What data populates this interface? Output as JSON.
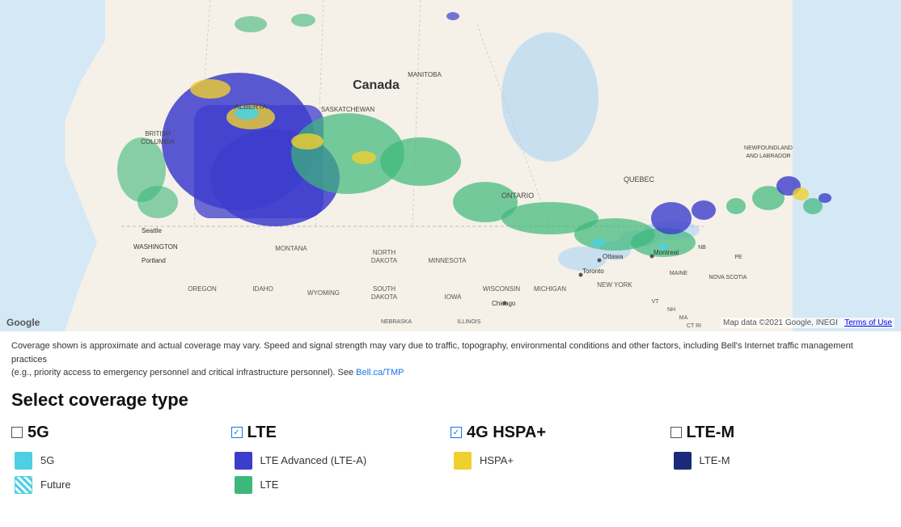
{
  "map": {
    "attribution": "Map data ©2021 Google, INEGI",
    "terms": "Terms of Use",
    "google_logo": "Google"
  },
  "disclaimer": {
    "text1": "Coverage shown is approximate and actual coverage may vary. Speed and signal strength may vary due to traffic, topography, environmental conditions and other factors, including Bell's Internet traffic management practices",
    "text2": "(e.g., priority access to emergency personnel and critical infrastructure personnel). See",
    "link_text": "Bell.ca/TMP",
    "link_href": "#"
  },
  "select_coverage_type": {
    "title": "Select coverage type"
  },
  "coverage_types": [
    {
      "id": "5g",
      "name": "5G",
      "checked": false,
      "items": [
        {
          "id": "5g-coverage",
          "label": "5G",
          "swatch": "swatch-5g"
        },
        {
          "id": "5g-future",
          "label": "Future",
          "swatch": "swatch-future"
        }
      ]
    },
    {
      "id": "lte",
      "name": "LTE",
      "checked": true,
      "items": [
        {
          "id": "lte-advanced",
          "label": "LTE Advanced (LTE-A)",
          "swatch": "swatch-lte-advanced"
        },
        {
          "id": "lte-coverage",
          "label": "LTE",
          "swatch": "swatch-lte"
        }
      ]
    },
    {
      "id": "4g-hspa",
      "name": "4G HSPA+",
      "checked": true,
      "items": [
        {
          "id": "hspa-coverage",
          "label": "HSPA+",
          "swatch": "swatch-hspa"
        }
      ]
    },
    {
      "id": "lte-m",
      "name": "LTE-M",
      "checked": false,
      "items": [
        {
          "id": "lte-m-coverage",
          "label": "LTE-M",
          "swatch": "swatch-lte-m"
        }
      ]
    }
  ],
  "map_labels": {
    "canada": "Canada",
    "alberta": "ALBERTA",
    "british_columbia": "BRITISH COLUMBIA",
    "saskatchewan": "SASKATCHEWAN",
    "manitoba": "MANITOBA",
    "ontario": "ONTARIO",
    "quebec": "QUEBEC",
    "newfoundland": "NEWFOUNDLAND AND LABRADOR",
    "nova_scotia": "NOVA SCOTIA",
    "nb": "NB",
    "pe": "PE",
    "maine": "MAINE",
    "vermont": "VT",
    "new_hampshire": "NH",
    "massachusetts": "MA",
    "connecticut": "CT RI",
    "north_dakota": "NORTH DAKOTA",
    "south_dakota": "SOUTH DAKOTA",
    "minnesota": "MINNESOTA",
    "wisconsin": "WISCONSIN",
    "michigan": "MICHIGAN",
    "new_york": "NEW YORK",
    "iowa": "IOWA",
    "nebraska": "NEBRASKA",
    "wyoming": "WYOMING",
    "idaho": "IDAHO",
    "montana": "MONTANA",
    "oregon": "OREGON",
    "washington": "WASHINGTON",
    "seattle": "Seattle",
    "portland": "Portland",
    "ottawa": "Ottawa",
    "toronto": "Toronto",
    "montreal": "Montreal",
    "chicago": "Chicago"
  }
}
